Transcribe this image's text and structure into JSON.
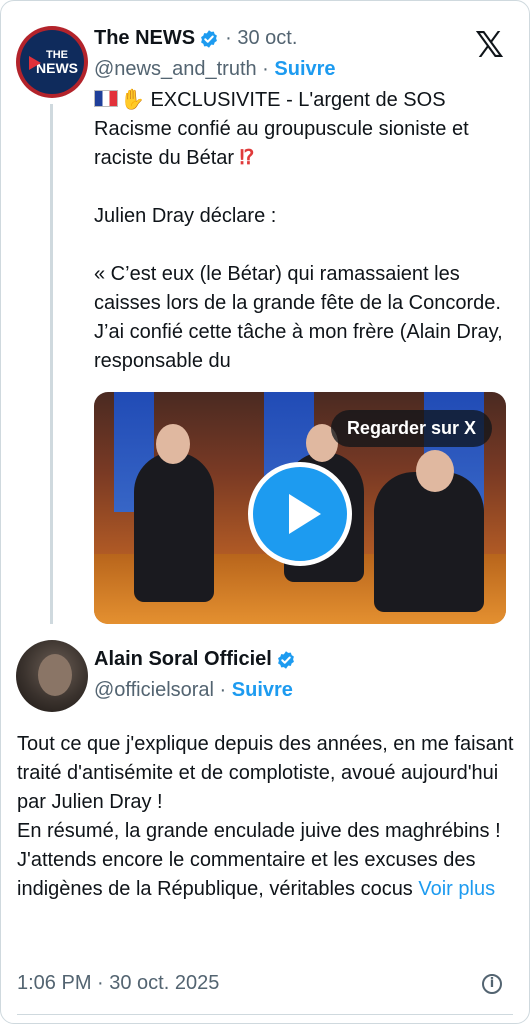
{
  "quoted_tweet": {
    "author_name": "The NEWS",
    "date": "· 30 oct.",
    "handle": "@news_and_truth ·",
    "follow_label": "Suivre",
    "avatar_text_top": "THE",
    "avatar_text_bottom": "NEWS",
    "paragraphs": [
      "EXCLUSIVITE  - L'argent de SOS Racisme confié au groupuscule sioniste et raciste du Bétar",
      "Julien Dray déclare :",
      "« C’est eux (le Bétar) qui ramassaient les caisses lors de la grande fête de la Concorde. J’ai confié cette tâche à mon frère (Alain Dray, responsable du"
    ],
    "emoji_marks": "⁉",
    "hand_emoji": "✋",
    "video": {
      "watch_label": "Regarder sur X"
    }
  },
  "main_tweet": {
    "author_name": "Alain Soral Officiel",
    "handle": "@officielsoral ·",
    "follow_label": "Suivre",
    "body_lines": [
      "Tout ce que j'explique depuis des années, en me faisant traité d'antisémite et de complotiste, avoué aujourd'hui par Julien Dray !",
      "En résumé, la grande enculade juive des maghrébins !",
      "J'attends encore le commentaire et les excuses des indigènes de la République, véritables cocus"
    ],
    "see_more": "Voir plus",
    "timestamp": "1:06 PM · 30 oct. 2025"
  },
  "icons": {
    "verified": "verified-badge-icon",
    "x_logo": "x-logo-icon",
    "info": "info-icon",
    "play": "play-icon"
  },
  "colors": {
    "accent": "#1d9bf0",
    "muted": "#536471",
    "text": "#0f1419",
    "border": "#cfd9de"
  }
}
